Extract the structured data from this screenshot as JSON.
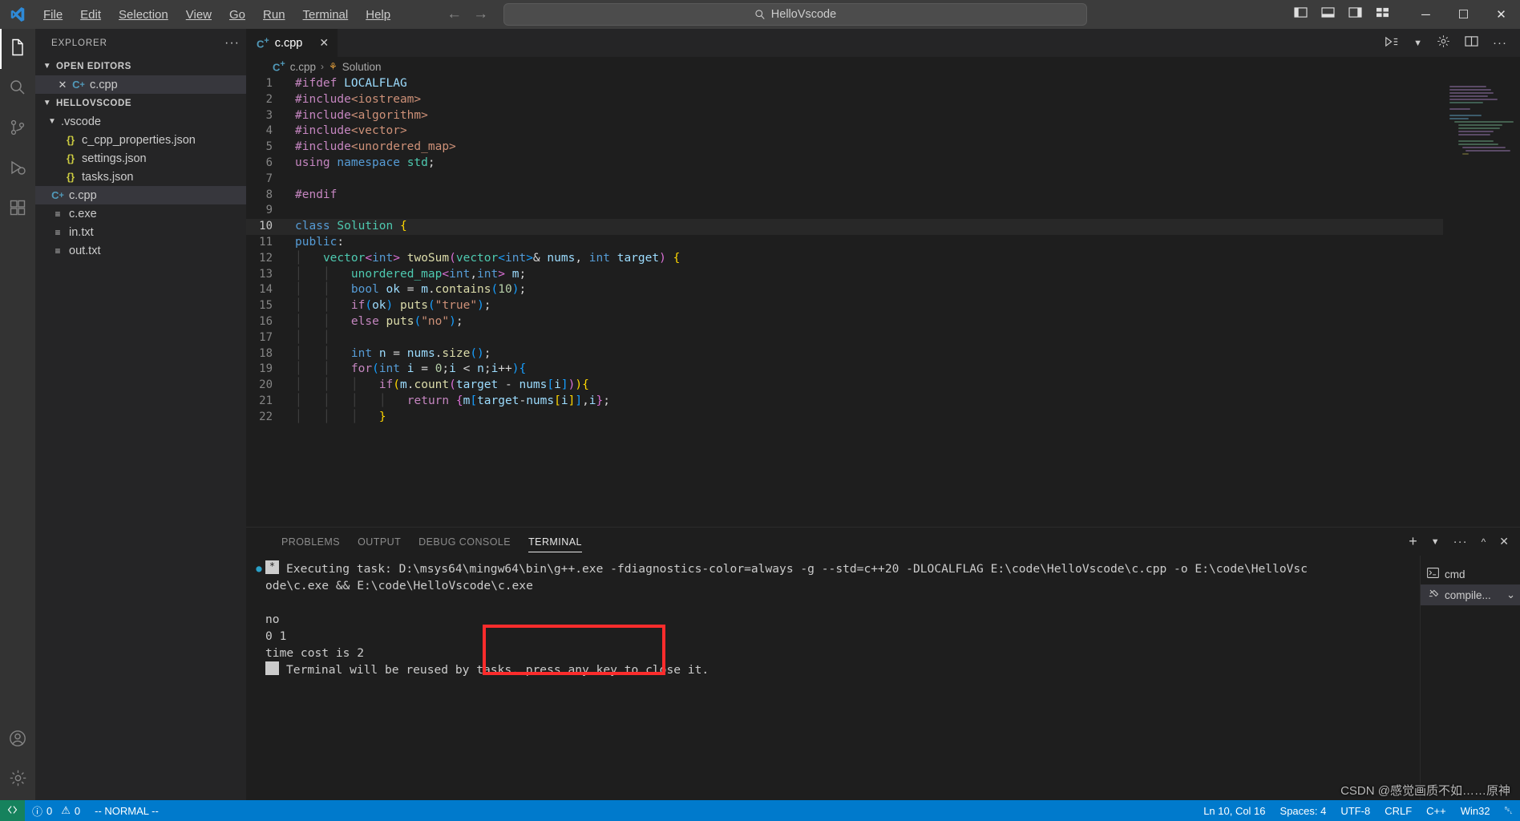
{
  "titlebar": {
    "menus": [
      "File",
      "Edit",
      "Selection",
      "View",
      "Go",
      "Run",
      "Terminal",
      "Help"
    ],
    "back_icon": "arrow-left-icon",
    "forward_icon": "arrow-right-icon",
    "search": {
      "value": "HelloVscode",
      "icon": "search-icon"
    },
    "layout_icons": [
      "toggle-primary-sidebar-icon",
      "toggle-panel-icon",
      "toggle-secondary-sidebar-icon",
      "customize-layout-icon"
    ],
    "window": {
      "minimize": "─",
      "maximize": "☐",
      "close": "✕"
    }
  },
  "activitybar": {
    "items": [
      {
        "name": "explorer",
        "icon": "files-icon",
        "active": true
      },
      {
        "name": "search",
        "icon": "search-icon",
        "active": false
      },
      {
        "name": "source-control",
        "icon": "source-control-icon",
        "active": false
      },
      {
        "name": "run-debug",
        "icon": "debug-icon",
        "active": false
      },
      {
        "name": "extensions",
        "icon": "extensions-icon",
        "active": false
      }
    ],
    "bottom": [
      {
        "name": "accounts",
        "icon": "account-icon"
      },
      {
        "name": "manage",
        "icon": "gear-icon"
      }
    ]
  },
  "sidebar": {
    "title": "EXPLORER",
    "more_actions": "···",
    "sections": [
      {
        "label": "OPEN EDITORS",
        "expanded": true,
        "items": [
          {
            "label": "c.cpp",
            "icon": "cpp-file-icon",
            "selected": true,
            "has_close": true,
            "indent": 1
          }
        ]
      },
      {
        "label": "HELLOVSCODE",
        "expanded": true,
        "items": [
          {
            "label": ".vscode",
            "icon": "folder-open-icon",
            "selected": false,
            "indent": 1
          },
          {
            "label": "c_cpp_properties.json",
            "icon": "json-file-icon",
            "selected": false,
            "indent": 2
          },
          {
            "label": "settings.json",
            "icon": "json-file-icon",
            "selected": false,
            "indent": 2
          },
          {
            "label": "tasks.json",
            "icon": "json-file-icon",
            "selected": false,
            "indent": 2
          },
          {
            "label": "c.cpp",
            "icon": "cpp-file-icon",
            "selected": true,
            "indent": 1
          },
          {
            "label": "c.exe",
            "icon": "text-file-icon",
            "selected": false,
            "indent": 1
          },
          {
            "label": "in.txt",
            "icon": "text-file-icon",
            "selected": false,
            "indent": 1
          },
          {
            "label": "out.txt",
            "icon": "text-file-icon",
            "selected": false,
            "indent": 1
          }
        ]
      }
    ]
  },
  "editor": {
    "tab": {
      "label": "c.cpp",
      "icon": "cpp-file-icon",
      "close": "✕"
    },
    "actions": [
      "run-code-icon",
      "chevron-down-icon",
      "settings-gear-icon",
      "split-editor-icon",
      "more-actions-icon"
    ],
    "breadcrumb": [
      {
        "label": "c.cpp",
        "icon": "cpp-file-icon"
      },
      {
        "label": "Solution",
        "icon": "class-symbol-icon"
      }
    ],
    "breadcrumb_separator": "›",
    "active_line": 10,
    "lines": [
      {
        "n": 1,
        "text": "#ifdef LOCALFLAG"
      },
      {
        "n": 2,
        "text": "#include<iostream>"
      },
      {
        "n": 3,
        "text": "#include<algorithm>"
      },
      {
        "n": 4,
        "text": "#include<vector>"
      },
      {
        "n": 5,
        "text": "#include<unordered_map>"
      },
      {
        "n": 6,
        "text": "using namespace std;"
      },
      {
        "n": 7,
        "text": ""
      },
      {
        "n": 8,
        "text": "#endif"
      },
      {
        "n": 9,
        "text": ""
      },
      {
        "n": 10,
        "text": "class Solution {"
      },
      {
        "n": 11,
        "text": "public:"
      },
      {
        "n": 12,
        "text": "    vector<int> twoSum(vector<int>& nums, int target) {"
      },
      {
        "n": 13,
        "text": "        unordered_map<int,int> m;"
      },
      {
        "n": 14,
        "text": "        bool ok = m.contains(10);"
      },
      {
        "n": 15,
        "text": "        if(ok) puts(\"true\");"
      },
      {
        "n": 16,
        "text": "        else puts(\"no\");"
      },
      {
        "n": 17,
        "text": ""
      },
      {
        "n": 18,
        "text": "        int n = nums.size();"
      },
      {
        "n": 19,
        "text": "        for(int i = 0;i < n;i++){"
      },
      {
        "n": 20,
        "text": "            if(m.count(target - nums[i])){"
      },
      {
        "n": 21,
        "text": "                return {m[target-nums[i]],i};"
      },
      {
        "n": 22,
        "text": "            }"
      }
    ]
  },
  "panel": {
    "tabs": [
      {
        "label": "PROBLEMS",
        "active": false
      },
      {
        "label": "OUTPUT",
        "active": false
      },
      {
        "label": "DEBUG CONSOLE",
        "active": false
      },
      {
        "label": "TERMINAL",
        "active": true
      }
    ],
    "actions": [
      "new-terminal-icon",
      "chevron-down-icon",
      "more-actions-icon",
      "chevron-up-icon",
      "close-panel-icon"
    ],
    "terminal": {
      "task_marker": "*",
      "command_line_1": "Executing task: D:\\msys64\\mingw64\\bin\\g++.exe -fdiagnostics-color=always -g --std=c++20 -DLOCALFLAG E:\\code\\HelloVscode\\c.cpp -o E:\\code\\HelloVsc",
      "command_line_2": "ode\\c.exe && E:\\code\\HelloVscode\\c.exe",
      "output": [
        "no",
        "0 1",
        "time cost is 2"
      ],
      "footer": "Terminal will be reused by tasks, press any key to close it.",
      "highlight_color": "#fb2c2c"
    },
    "sessions": [
      {
        "label": "cmd",
        "icon": "cmd-terminal-icon",
        "active": false
      },
      {
        "label": "compile...",
        "icon": "task-terminal-icon",
        "active": true,
        "chevron": "⌄"
      }
    ]
  },
  "statusbar": {
    "remote_icon": "remote-window-icon",
    "problems": {
      "errors_icon": "error-icon",
      "errors": "0",
      "warnings_icon": "warning-icon",
      "warnings": "0"
    },
    "mode": "-- NORMAL --",
    "right": [
      {
        "name": "cursor-position",
        "label": "Ln 10, Col 16"
      },
      {
        "name": "indentation",
        "label": "Spaces: 4"
      },
      {
        "name": "encoding",
        "label": "UTF-8"
      },
      {
        "name": "eol",
        "label": "CRLF"
      },
      {
        "name": "language-mode",
        "label": "C++"
      },
      {
        "name": "win32-mode",
        "label": "Win32"
      },
      {
        "name": "notifications",
        "label": "␇"
      }
    ],
    "accent": "#007acc"
  },
  "watermark": "CSDN @感觉画质不如……原神"
}
